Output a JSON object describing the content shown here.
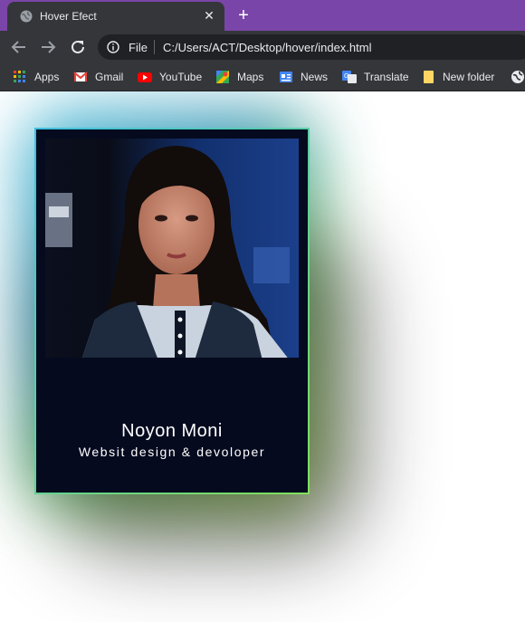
{
  "tab": {
    "title": "Hover Efect",
    "close_label": "✕",
    "new_tab_label": "+"
  },
  "omnibox": {
    "scheme_label": "File",
    "url": "C:/Users/ACT/Desktop/hover/index.html"
  },
  "bookmarks": [
    {
      "label": "Apps",
      "icon": "apps-grid-icon"
    },
    {
      "label": "Gmail",
      "icon": "gmail-icon"
    },
    {
      "label": "YouTube",
      "icon": "youtube-icon"
    },
    {
      "label": "Maps",
      "icon": "maps-icon"
    },
    {
      "label": "News",
      "icon": "news-icon"
    },
    {
      "label": "Translate",
      "icon": "translate-icon"
    },
    {
      "label": "New folder",
      "icon": "folder-icon"
    }
  ],
  "card": {
    "name": "Noyon Moni",
    "role": "Websit design & devoloper"
  },
  "colors": {
    "tab_strip": "#7a45a8",
    "card_bg": "#050a1f",
    "glow_cyan": "#3fb9d8",
    "glow_green": "#b6ef4a"
  }
}
